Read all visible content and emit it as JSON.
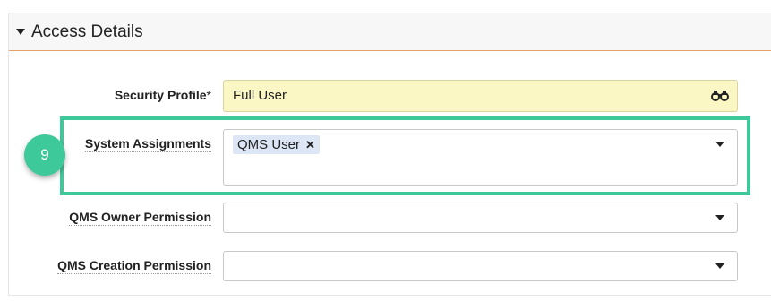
{
  "section": {
    "title": "Access Details"
  },
  "fields": {
    "security_profile": {
      "label": "Security Profile",
      "required_mark": "*",
      "value": "Full User"
    },
    "system_assignments": {
      "label": "System Assignments",
      "tags": [
        "QMS User"
      ]
    },
    "qms_owner_permission": {
      "label": "QMS Owner Permission",
      "value": ""
    },
    "qms_creation_permission": {
      "label": "QMS Creation Permission",
      "value": ""
    }
  },
  "annotation": {
    "step_number": "9"
  },
  "colors": {
    "highlight": "#3ec99a",
    "lookup_field_bg": "#fbf7c4",
    "tag_bg": "#dce6f5",
    "header_rule": "#e8a06a"
  },
  "icons": {
    "section_toggle": "caret-down-icon",
    "lookup": "binoculars-icon",
    "dropdown": "chevron-down-icon",
    "tag_remove": "close-icon"
  }
}
